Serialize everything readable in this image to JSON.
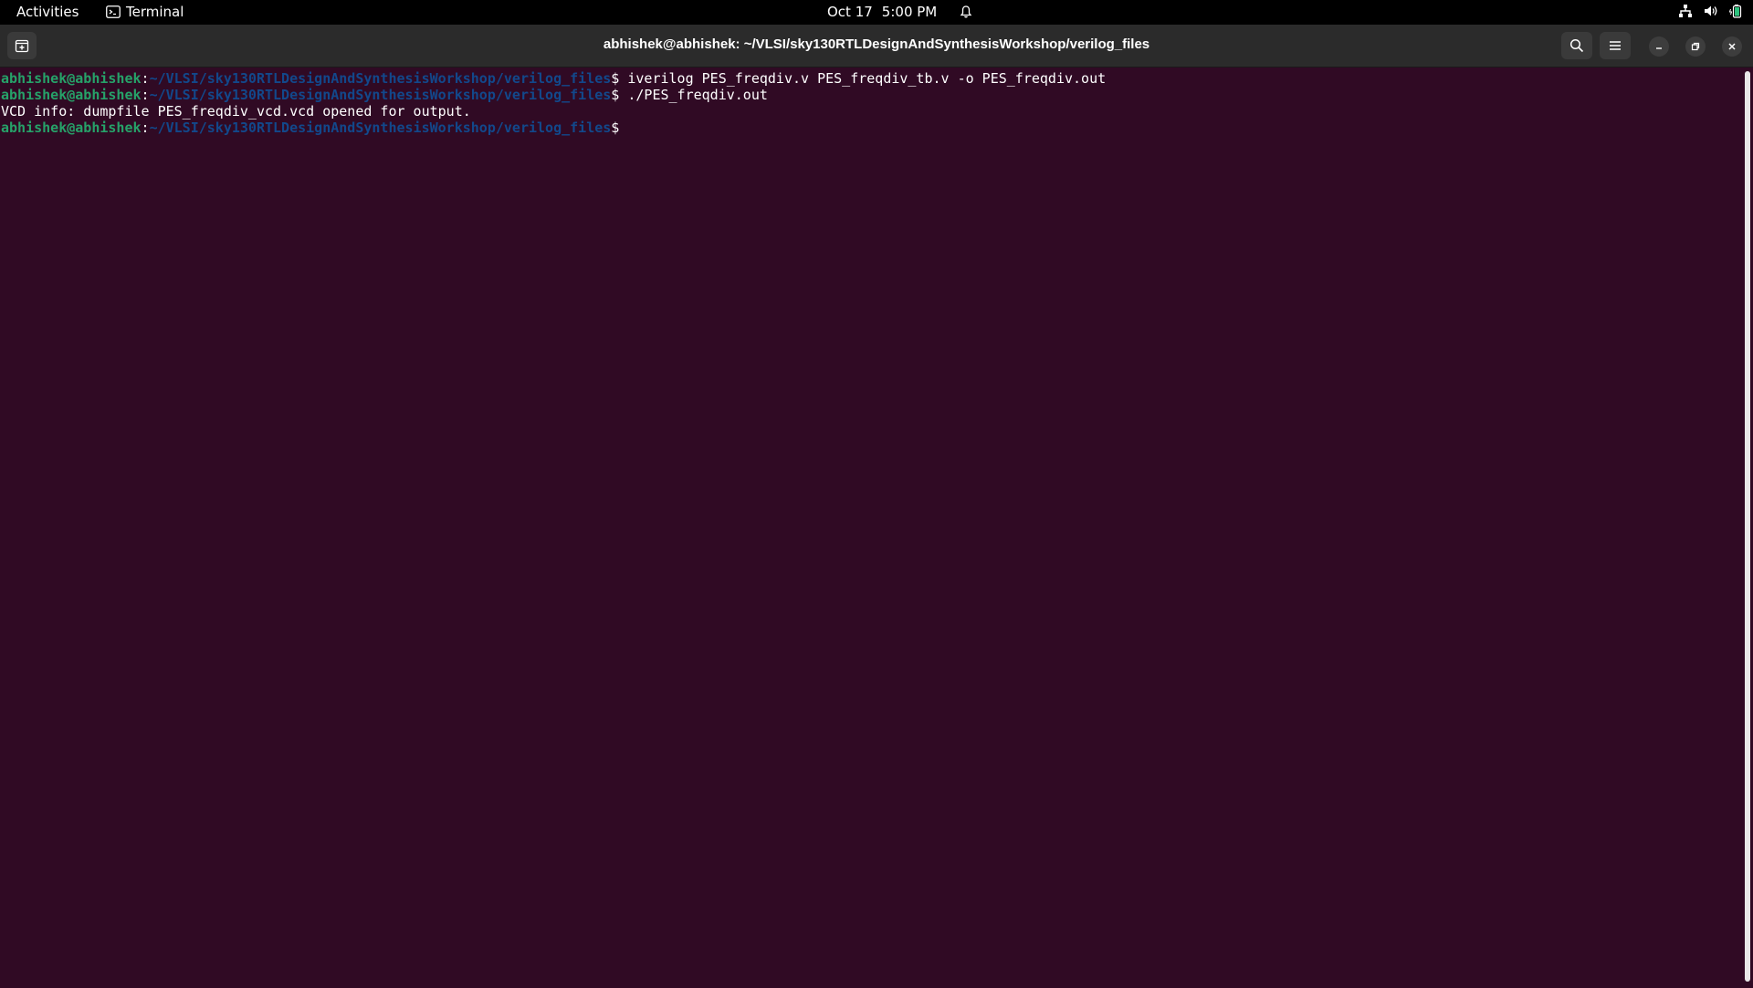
{
  "topbar": {
    "activities": "Activities",
    "app_name": "Terminal",
    "date": "Oct 17",
    "time": "5:00 PM"
  },
  "window": {
    "title": "abhishek@abhishek: ~/VLSI/sky130RTLDesignAndSynthesisWorkshop/verilog_files"
  },
  "terminal": {
    "prompt_user": "abhishek@abhishek",
    "prompt_colon": ":",
    "prompt_path": "~/VLSI/sky130RTLDesignAndSynthesisWorkshop/verilog_files",
    "prompt_dollar": "$",
    "cmd1": " iverilog PES_freqdiv.v PES_freqdiv_tb.v -o PES_freqdiv.out",
    "cmd2": " ./PES_freqdiv.out",
    "output1": "VCD info: dumpfile PES_freqdiv_vcd.vcd opened for output.",
    "cmd3": ""
  },
  "colors": {
    "terminal_bg": "#300a24",
    "prompt_user": "#26a269",
    "prompt_path": "#12488b"
  },
  "icons": {
    "new_tab": "new-tab-icon",
    "search": "search-icon",
    "menu": "hamburger-menu-icon",
    "minimize": "minimize-icon",
    "maximize": "restore-icon",
    "close": "close-icon",
    "network": "network-icon",
    "volume": "volume-icon",
    "battery": "battery-icon",
    "notification": "bell-icon",
    "terminal_app": "terminal-icon"
  }
}
